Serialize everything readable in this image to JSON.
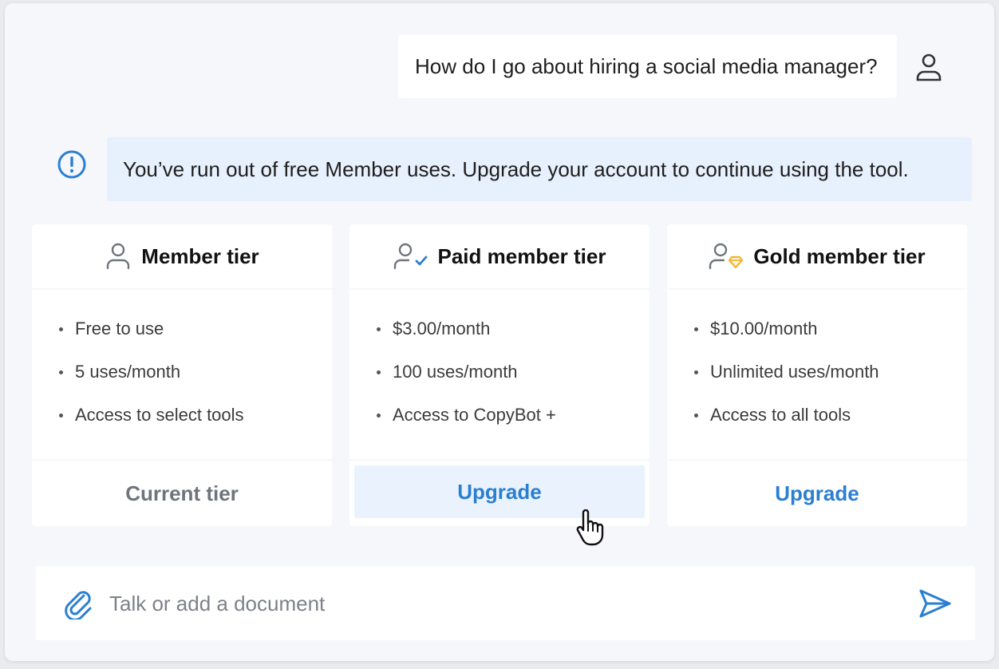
{
  "conversation": {
    "user_message": "How do I go about hiring a social media manager?",
    "user_avatar_icon": "user-icon"
  },
  "alert": {
    "icon": "info-circle-icon",
    "text": "You’ve run out of free Member uses. Upgrade your account to continue using the tool."
  },
  "tiers": [
    {
      "title": "Member tier",
      "icon": "user-icon",
      "features": [
        "Free to use",
        "5 uses/month",
        "Access to select tools"
      ],
      "action_label": "Current tier",
      "action_state": "current"
    },
    {
      "title": "Paid member tier",
      "icon": "user-check-icon",
      "features": [
        "$3.00/month",
        "100 uses/month",
        "Access to CopyBot +"
      ],
      "action_label": "Upgrade",
      "action_state": "upgrade-hovered"
    },
    {
      "title": "Gold member tier",
      "icon": "user-diamond-icon",
      "features": [
        "$10.00/month",
        "Unlimited uses/month",
        "Access to all tools"
      ],
      "action_label": "Upgrade",
      "action_state": "upgrade"
    }
  ],
  "composer": {
    "placeholder": "Talk or add a document",
    "attach_icon": "paperclip-icon",
    "send_icon": "send-icon"
  },
  "colors": {
    "accent": "#2a7fd1",
    "alert_bg": "#e7f0fd",
    "gold": "#f2b431",
    "page_bg": "#f6f7fb"
  }
}
